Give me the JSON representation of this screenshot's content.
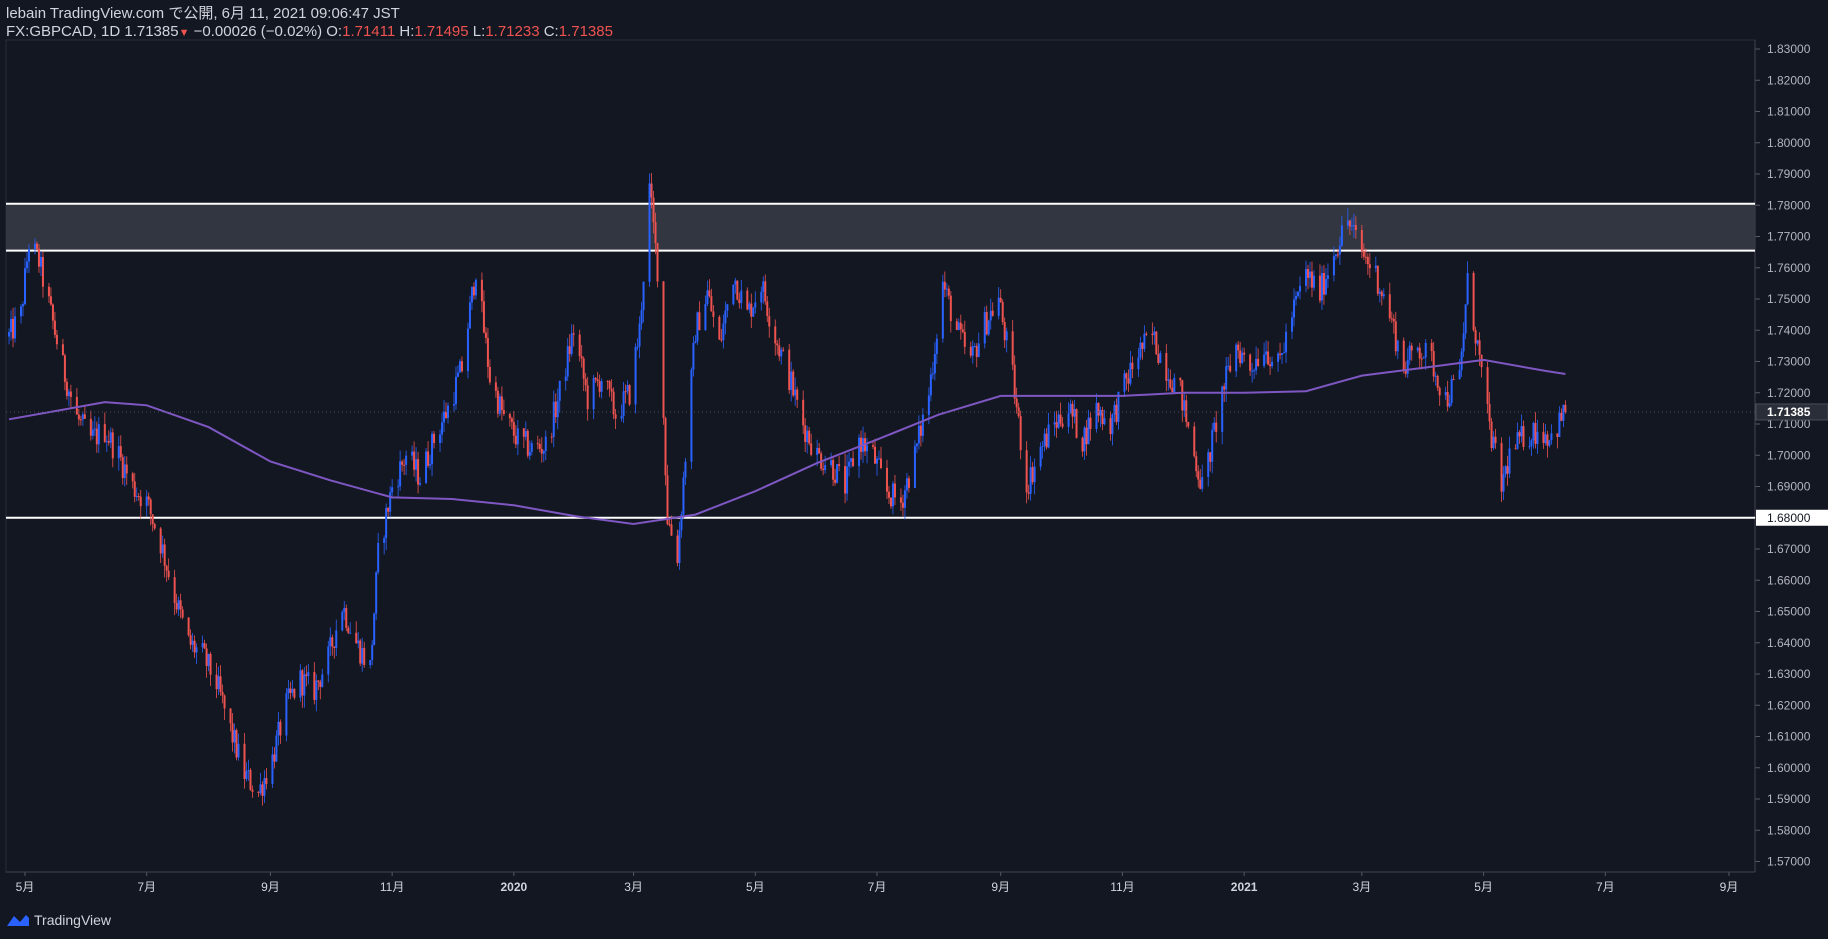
{
  "header": {
    "publisher_line": "lebain TradingView.com で公開, 6月 11, 2021 09:06:47 JST",
    "symbol_line": "FX:GBPCAD, 1D 1.71385",
    "change": "−0.00026 (−0.02%)",
    "o_label": "O:",
    "o_value": "1.71411",
    "h_label": "H:",
    "h_value": "1.71495",
    "l_label": "L:",
    "l_value": "1.71233",
    "c_label": "C:",
    "c_value": "1.71385"
  },
  "footer": {
    "brand": "TradingView"
  },
  "colors": {
    "background": "#131722",
    "up": "#2962ff",
    "down": "#ef5350",
    "ma": "#7e57c2",
    "level_line": "#ffffff",
    "zone_fill": "#363a45"
  },
  "chart_data": {
    "type": "candlestick",
    "symbol": "GBPCAD",
    "interval": "1D",
    "price_axis": {
      "ylim": [
        1.565,
        1.833
      ],
      "ticks": [
        "1.83000",
        "1.82000",
        "1.81000",
        "1.80000",
        "1.79000",
        "1.78000",
        "1.77000",
        "1.76000",
        "1.75000",
        "1.74000",
        "1.73000",
        "1.72000",
        "1.71000",
        "1.70000",
        "1.69000",
        "1.68000",
        "1.67000",
        "1.66000",
        "1.65000",
        "1.64000",
        "1.63000",
        "1.62000",
        "1.61000",
        "1.60000",
        "1.59000",
        "1.58000",
        "1.57000"
      ],
      "last_price": "1.71385",
      "level_label": "1.68000"
    },
    "time_axis": {
      "labels": [
        {
          "text": "5月",
          "date": "2019-05-01"
        },
        {
          "text": "7月",
          "date": "2019-07-01"
        },
        {
          "text": "9月",
          "date": "2019-09-01"
        },
        {
          "text": "11月",
          "date": "2019-11-01"
        },
        {
          "text": "2020",
          "date": "2020-01-01",
          "bold": true
        },
        {
          "text": "3月",
          "date": "2020-03-01"
        },
        {
          "text": "5月",
          "date": "2020-05-01"
        },
        {
          "text": "7月",
          "date": "2020-07-01"
        },
        {
          "text": "9月",
          "date": "2020-09-01"
        },
        {
          "text": "11月",
          "date": "2020-11-01"
        },
        {
          "text": "2021",
          "date": "2021-01-01",
          "bold": true
        },
        {
          "text": "3月",
          "date": "2021-03-01"
        },
        {
          "text": "5月",
          "date": "2021-05-01"
        },
        {
          "text": "7月",
          "date": "2021-07-01"
        },
        {
          "text": "9月",
          "date": "2021-09-01"
        }
      ]
    },
    "resistance_zone": [
      1.7655,
      1.7805
    ],
    "support_level": 1.68,
    "close_path": [
      [
        "2019-04-23",
        1.738
      ],
      [
        "2019-04-29",
        1.745
      ],
      [
        "2019-05-03",
        1.768
      ],
      [
        "2019-05-08",
        1.762
      ],
      [
        "2019-05-13",
        1.748
      ],
      [
        "2019-05-20",
        1.728
      ],
      [
        "2019-05-27",
        1.712
      ],
      [
        "2019-06-03",
        1.705
      ],
      [
        "2019-06-10",
        1.708
      ],
      [
        "2019-06-17",
        1.7
      ],
      [
        "2019-06-24",
        1.69
      ],
      [
        "2019-07-01",
        1.685
      ],
      [
        "2019-07-08",
        1.672
      ],
      [
        "2019-07-15",
        1.655
      ],
      [
        "2019-07-22",
        1.64
      ],
      [
        "2019-07-29",
        1.636
      ],
      [
        "2019-08-05",
        1.627
      ],
      [
        "2019-08-12",
        1.612
      ],
      [
        "2019-08-19",
        1.598
      ],
      [
        "2019-08-26",
        1.592
      ],
      [
        "2019-09-02",
        1.603
      ],
      [
        "2019-09-09",
        1.62
      ],
      [
        "2019-09-16",
        1.628
      ],
      [
        "2019-09-23",
        1.625
      ],
      [
        "2019-09-30",
        1.635
      ],
      [
        "2019-10-07",
        1.652
      ],
      [
        "2019-10-14",
        1.64
      ],
      [
        "2019-10-21",
        1.632
      ],
      [
        "2019-10-25",
        1.668
      ],
      [
        "2019-11-01",
        1.69
      ],
      [
        "2019-11-08",
        1.7
      ],
      [
        "2019-11-15",
        1.693
      ],
      [
        "2019-11-22",
        1.705
      ],
      [
        "2019-11-29",
        1.715
      ],
      [
        "2019-12-06",
        1.728
      ],
      [
        "2019-12-13",
        1.76
      ],
      [
        "2019-12-20",
        1.725
      ],
      [
        "2019-12-27",
        1.712
      ],
      [
        "2020-01-03",
        1.705
      ],
      [
        "2020-01-10",
        1.702
      ],
      [
        "2020-01-17",
        1.703
      ],
      [
        "2020-01-24",
        1.72
      ],
      [
        "2020-01-31",
        1.74
      ],
      [
        "2020-02-07",
        1.718
      ],
      [
        "2020-02-14",
        1.725
      ],
      [
        "2020-02-21",
        1.713
      ],
      [
        "2020-02-28",
        1.72
      ],
      [
        "2020-03-04",
        1.74
      ],
      [
        "2020-03-09",
        1.785
      ],
      [
        "2020-03-13",
        1.76
      ],
      [
        "2020-03-18",
        1.68
      ],
      [
        "2020-03-23",
        1.668
      ],
      [
        "2020-03-27",
        1.7
      ],
      [
        "2020-04-01",
        1.74
      ],
      [
        "2020-04-07",
        1.752
      ],
      [
        "2020-04-13",
        1.735
      ],
      [
        "2020-04-20",
        1.758
      ],
      [
        "2020-04-27",
        1.745
      ],
      [
        "2020-05-04",
        1.755
      ],
      [
        "2020-05-11",
        1.738
      ],
      [
        "2020-05-18",
        1.725
      ],
      [
        "2020-05-25",
        1.71
      ],
      [
        "2020-06-01",
        1.7
      ],
      [
        "2020-06-08",
        1.697
      ],
      [
        "2020-06-15",
        1.69
      ],
      [
        "2020-06-22",
        1.705
      ],
      [
        "2020-06-29",
        1.7
      ],
      [
        "2020-07-06",
        1.688
      ],
      [
        "2020-07-13",
        1.685
      ],
      [
        "2020-07-20",
        1.7
      ],
      [
        "2020-07-27",
        1.72
      ],
      [
        "2020-08-03",
        1.755
      ],
      [
        "2020-08-10",
        1.74
      ],
      [
        "2020-08-17",
        1.73
      ],
      [
        "2020-08-24",
        1.742
      ],
      [
        "2020-08-31",
        1.75
      ],
      [
        "2020-09-07",
        1.725
      ],
      [
        "2020-09-14",
        1.69
      ],
      [
        "2020-09-21",
        1.702
      ],
      [
        "2020-09-28",
        1.71
      ],
      [
        "2020-10-05",
        1.715
      ],
      [
        "2020-10-12",
        1.705
      ],
      [
        "2020-10-19",
        1.715
      ],
      [
        "2020-10-26",
        1.71
      ],
      [
        "2020-11-02",
        1.722
      ],
      [
        "2020-11-09",
        1.733
      ],
      [
        "2020-11-16",
        1.738
      ],
      [
        "2020-11-23",
        1.728
      ],
      [
        "2020-11-30",
        1.72
      ],
      [
        "2020-12-07",
        1.7
      ],
      [
        "2020-12-11",
        1.69
      ],
      [
        "2020-12-14",
        1.698
      ],
      [
        "2020-12-21",
        1.72
      ],
      [
        "2020-12-28",
        1.735
      ],
      [
        "2021-01-04",
        1.728
      ],
      [
        "2021-01-11",
        1.735
      ],
      [
        "2021-01-18",
        1.728
      ],
      [
        "2021-01-25",
        1.745
      ],
      [
        "2021-02-01",
        1.758
      ],
      [
        "2021-02-08",
        1.752
      ],
      [
        "2021-02-15",
        1.765
      ],
      [
        "2021-02-22",
        1.775
      ],
      [
        "2021-03-01",
        1.765
      ],
      [
        "2021-03-08",
        1.758
      ],
      [
        "2021-03-15",
        1.745
      ],
      [
        "2021-03-22",
        1.728
      ],
      [
        "2021-03-29",
        1.735
      ],
      [
        "2021-04-05",
        1.73
      ],
      [
        "2021-04-12",
        1.718
      ],
      [
        "2021-04-19",
        1.725
      ],
      [
        "2021-04-23",
        1.755
      ],
      [
        "2021-04-28",
        1.735
      ],
      [
        "2021-05-03",
        1.712
      ],
      [
        "2021-05-10",
        1.69
      ],
      [
        "2021-05-14",
        1.7
      ],
      [
        "2021-05-21",
        1.706
      ],
      [
        "2021-05-28",
        1.708
      ],
      [
        "2021-06-04",
        1.706
      ],
      [
        "2021-06-11",
        1.7139
      ]
    ],
    "moving_average": [
      [
        "2019-04-23",
        1.7115
      ],
      [
        "2019-05-15",
        1.714
      ],
      [
        "2019-06-10",
        1.717
      ],
      [
        "2019-07-01",
        1.716
      ],
      [
        "2019-08-01",
        1.709
      ],
      [
        "2019-09-01",
        1.698
      ],
      [
        "2019-10-01",
        1.692
      ],
      [
        "2019-11-01",
        1.6865
      ],
      [
        "2019-12-01",
        1.686
      ],
      [
        "2020-01-01",
        1.684
      ],
      [
        "2020-02-01",
        1.6805
      ],
      [
        "2020-03-01",
        1.678
      ],
      [
        "2020-04-01",
        1.681
      ],
      [
        "2020-05-01",
        1.6885
      ],
      [
        "2020-06-01",
        1.6975
      ],
      [
        "2020-07-01",
        1.705
      ],
      [
        "2020-08-01",
        1.713
      ],
      [
        "2020-09-01",
        1.719
      ],
      [
        "2020-10-01",
        1.719
      ],
      [
        "2020-11-01",
        1.719
      ],
      [
        "2020-12-01",
        1.72
      ],
      [
        "2021-01-01",
        1.72
      ],
      [
        "2021-02-01",
        1.7205
      ],
      [
        "2021-03-01",
        1.7255
      ],
      [
        "2021-04-01",
        1.728
      ],
      [
        "2021-05-01",
        1.7305
      ],
      [
        "2021-06-01",
        1.727
      ],
      [
        "2021-06-11",
        1.726
      ]
    ]
  }
}
